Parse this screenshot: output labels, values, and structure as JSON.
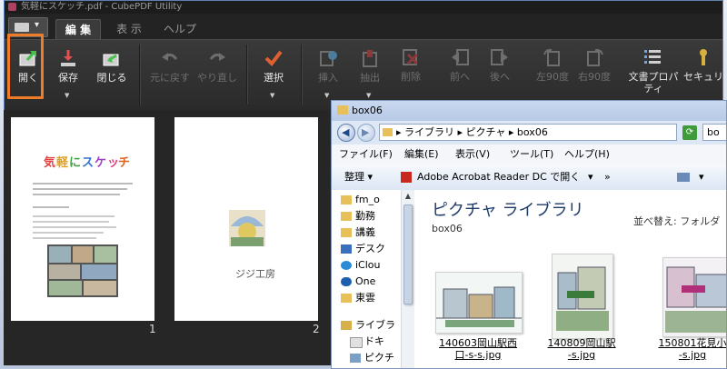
{
  "app": {
    "title": "気軽にスケッチ.pdf - CubePDF Utility",
    "tabs": [
      "編 集",
      "表 示",
      "ヘルプ"
    ]
  },
  "ribbon": {
    "open": "開く",
    "save": "保存",
    "close": "閉じる",
    "undo": "元に戻す",
    "redo": "やり直し",
    "select": "選択",
    "insert": "挿入",
    "extract": "抽出",
    "delete": "削除",
    "prev": "前へ",
    "next": "後へ",
    "rotate_left": "左90度",
    "rotate_right": "右90度",
    "properties": "文書プロパティ",
    "security": "セキュリテ"
  },
  "pages": {
    "page1_title": "気軽にスケッチ",
    "page1_number": "1",
    "page2_caption": "ジジ工房",
    "page2_number": "2"
  },
  "explorer": {
    "title": "box06",
    "address": "▸ ライブラリ ▸ ピクチャ ▸ box06",
    "search": "bo",
    "menu": [
      "ファイル(F)",
      "編集(E)",
      "表示(V)",
      "ツール(T)",
      "ヘルプ(H)"
    ],
    "commands": {
      "organize": "整理 ▾",
      "open_with": "Adobe Acrobat Reader DC で開く",
      "more": "»"
    },
    "nav_items": [
      "fm_o",
      "勤務",
      "講義",
      "デスク",
      "iClou",
      "One",
      "東雲",
      "ライブラ",
      "ドキ",
      "ピクチ"
    ],
    "library_title": "ピクチャ ライブラリ",
    "library_sub": "box06",
    "sort_label": "並べ替え:",
    "sort_value": "フォルダ",
    "files": [
      {
        "name": "140603岡山駅西口-s-s.jpg",
        "line1": "140603岡山駅西",
        "line2": "口-s-s.jpg"
      },
      {
        "name": "140809岡山駅-s.jpg",
        "line1": "140809岡山駅",
        "line2": "-s.jpg"
      },
      {
        "name": "150801花見小-s.jpg",
        "line1": "150801花見小",
        "line2": "-s.jpg"
      }
    ]
  },
  "colors": {
    "highlight": "#f07c2a",
    "app_bg": "#2a2a2a",
    "explorer_bg": "#eef3fb"
  }
}
